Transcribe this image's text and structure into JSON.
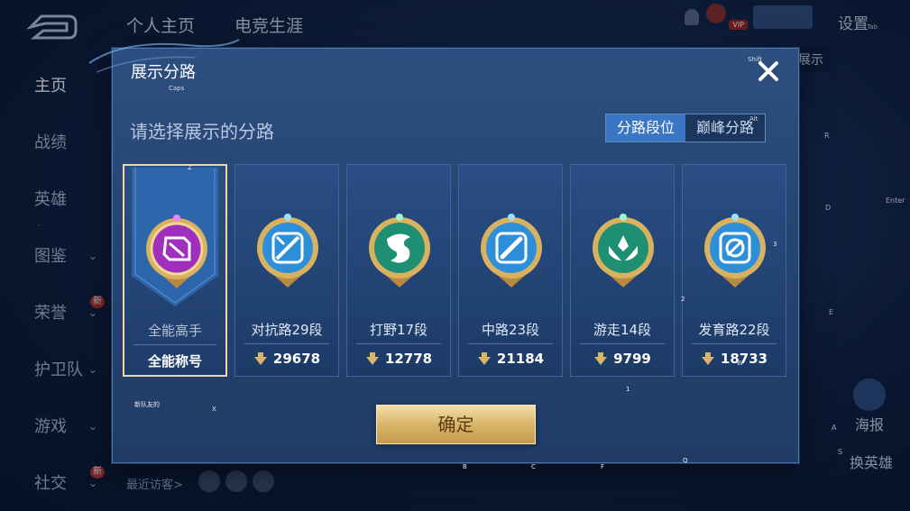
{
  "top_tabs": [
    "个人主页",
    "电竞生涯"
  ],
  "settings_label": "设置",
  "settings_hint": "Tab",
  "vip_label": "VIP",
  "side_nav": [
    {
      "label": "主页",
      "active": true
    },
    {
      "label": "战绩"
    },
    {
      "label": "英雄"
    },
    {
      "label": "图鉴",
      "chevron": true
    },
    {
      "label": "荣誉",
      "chevron": true,
      "badge": "新"
    },
    {
      "label": "护卫队",
      "chevron": true
    },
    {
      "label": "游戏",
      "chevron": true
    },
    {
      "label": "社交",
      "chevron": true,
      "badge": "新"
    }
  ],
  "side_hint": "-",
  "visitors_label": "最近访客>",
  "bg_right_button": "及数据展示",
  "poster_label": "海报",
  "swap_hero_label": "换英雄",
  "dialog": {
    "title": "展示分路",
    "subtitle": "请选择展示的分路",
    "caps_hint": "Caps",
    "close_hint": "Shift",
    "segments": [
      {
        "label": "分路段位",
        "active": true
      },
      {
        "label": "巅峰分路",
        "active": false
      }
    ],
    "seg_hint": "Alt",
    "cards": [
      {
        "name": "全能高手",
        "footer": "全能称号",
        "selected": true,
        "medal": "all",
        "medal_color": "#a12fbe",
        "hint": "Z"
      },
      {
        "name": "对抗路29段",
        "score": "29678",
        "medal": "sword",
        "medal_color": "#2d8fd9"
      },
      {
        "name": "打野17段",
        "score": "12778",
        "medal": "dragon",
        "medal_color": "#1f8f74"
      },
      {
        "name": "中路23段",
        "score": "21184",
        "medal": "staff",
        "medal_color": "#2d8fd9"
      },
      {
        "name": "游走14段",
        "score": "9799",
        "medal": "wings",
        "medal_color": "#1f8f74"
      },
      {
        "name": "发育路22段",
        "score": "18733",
        "medal": "target",
        "medal_color": "#2d8fd9",
        "hint": "3"
      }
    ],
    "confirm_label": "确定",
    "hints": {
      "bottom_left": "新队友的",
      "x_key": "X",
      "b_key": "B",
      "c_key": "C",
      "f_key": "F",
      "q_key": "Q",
      "one_key": "1",
      "two_key": "2",
      "w_key": "W"
    }
  },
  "bg_hints": {
    "R": "R",
    "D": "D",
    "Enter": "Enter",
    "E": "E",
    "A": "A",
    "S": "S"
  }
}
